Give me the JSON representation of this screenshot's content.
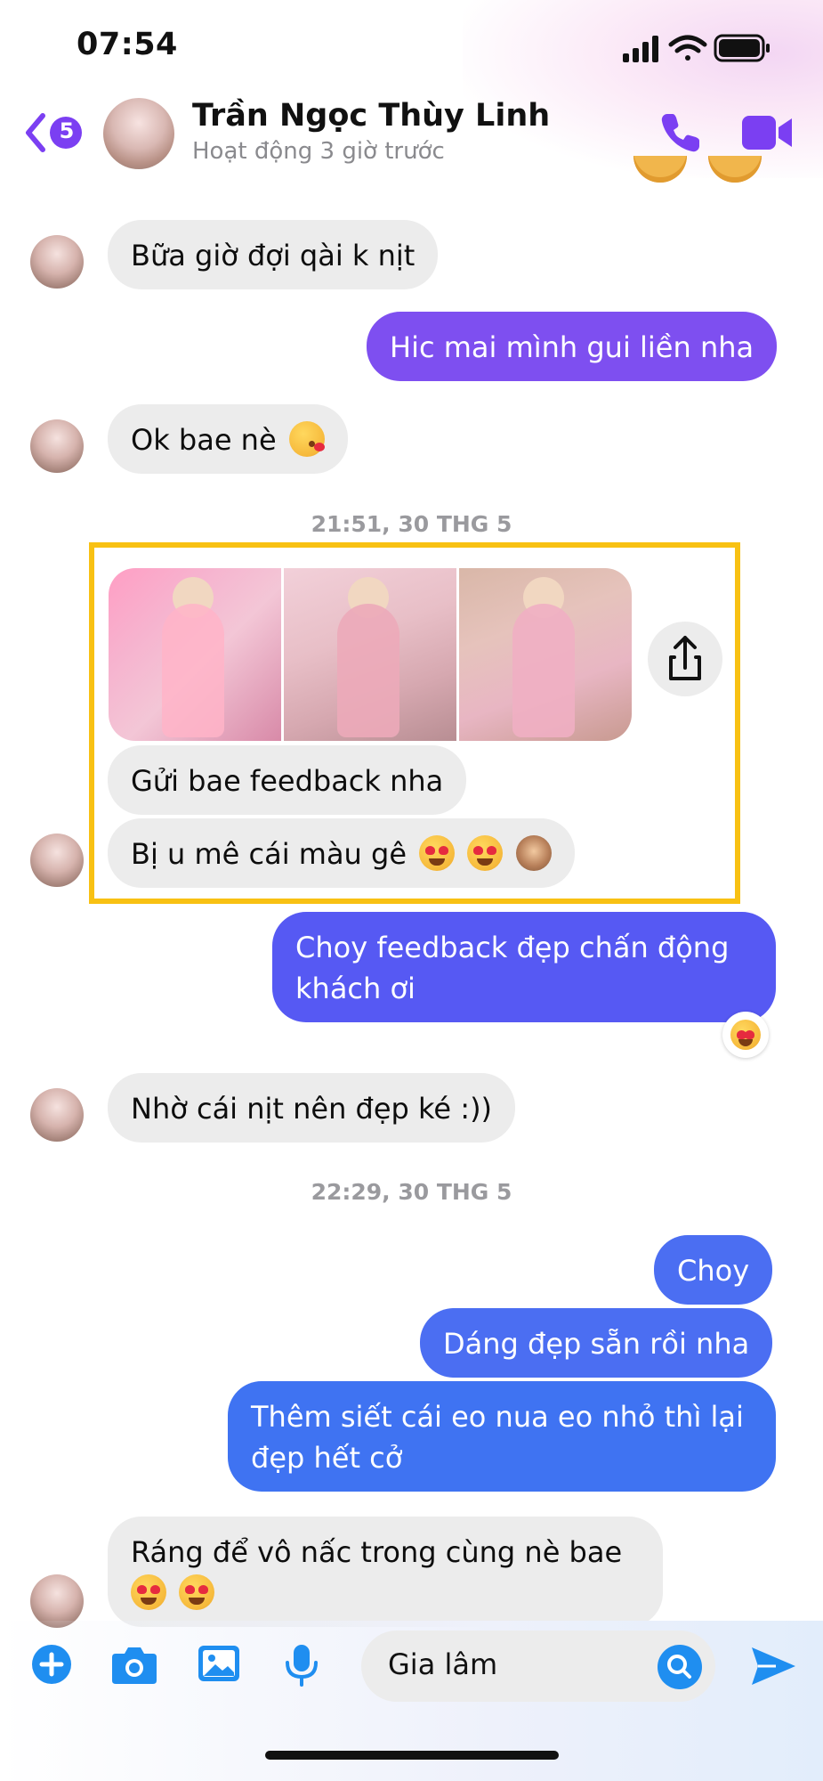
{
  "status_bar": {
    "time": "07:54"
  },
  "header": {
    "unread_count": "5",
    "contact_name": "Trần Ngọc Thùy Linh",
    "activity_status": "Hoạt động 3 giờ trước",
    "accent_color": "#7b3ff2"
  },
  "messages": {
    "m1": "Bữa giờ đợi qài k nịt",
    "m2": "Hic mai mình gui liền nha",
    "m3": "Ok bae nè",
    "ts1": "21:51, 30 THG 5",
    "m4": "Gửi bae feedback nha",
    "m5": "Bị u mê cái màu gê",
    "m6_line1": "Choy feedback đẹp chấn động",
    "m6_line2": "khách ơi",
    "m7": "Nhờ cái nịt nên đẹp ké :))",
    "ts2": "22:29, 30 THG 5",
    "m8": "Choy",
    "m9": "Dáng đẹp sẵn rồi nha",
    "m10_line1": "Thêm siết cái eo nua eo nhỏ thì lại",
    "m10_line2": "đẹp hết cở",
    "m11_line1": "Ráng để vô nấc trong cùng nè bae"
  },
  "icons": {
    "highlight_color": "#f8c113",
    "reaction": "smiling-face-with-hearts"
  },
  "composer": {
    "input_value": "Gia lâm"
  }
}
